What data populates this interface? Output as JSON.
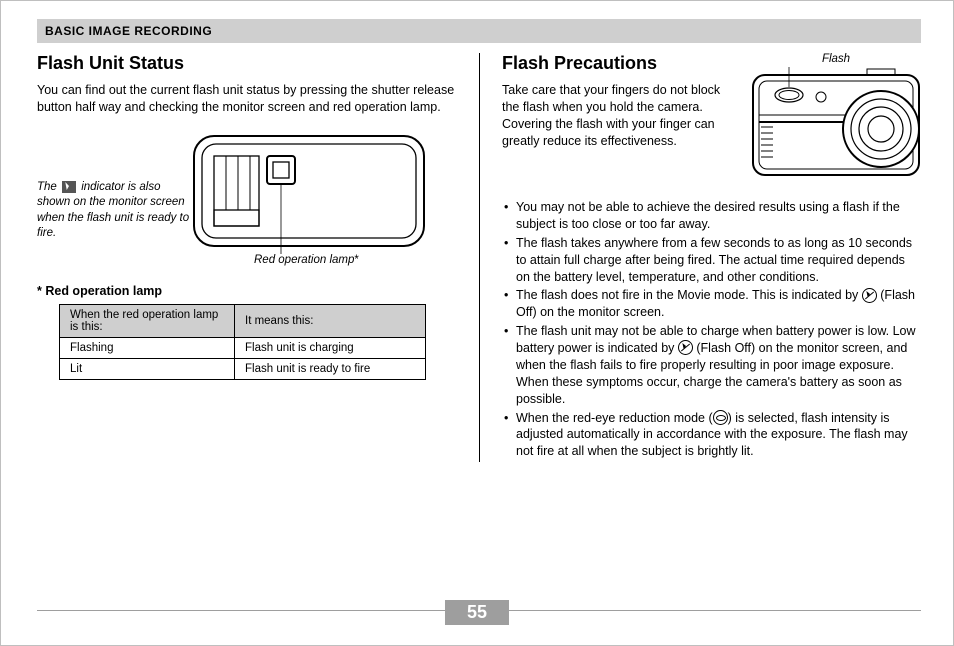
{
  "section_bar": "BASIC IMAGE RECORDING",
  "left": {
    "heading": "Flash Unit Status",
    "intro": "You can find out the current flash unit status by pressing the shutter release button half way and checking the monitor screen and red operation lamp.",
    "caption_before": "The ",
    "caption_after": " indicator is also shown on the monitor screen when the flash unit is ready to fire.",
    "lamp_label": "Red operation lamp",
    "subhead_prefix": "* ",
    "subhead": "Red operation lamp",
    "table": {
      "h1": "When the red operation lamp is this:",
      "h2": "It means this:",
      "r1c1": "Flashing",
      "r1c2": "Flash unit is charging",
      "r2c1": "Lit",
      "r2c2": "Flash unit is ready to fire"
    }
  },
  "right": {
    "heading": "Flash Precautions",
    "intro": "Take care that your fingers do not block the flash when you hold the camera. Covering the flash with your finger can greatly reduce its effectiveness.",
    "flash_label": "Flash",
    "bullets": {
      "b1": "You may not be able to achieve the desired results using a flash if the subject is too close or too far away.",
      "b2": "The flash takes anywhere from a few seconds to as long as 10 seconds to attain full charge after being fired. The actual time required depends on the battery level, temperature, and other conditions.",
      "b3a": "The flash does not fire in the Movie mode. This is indicated by ",
      "b3b": " (Flash Off) on the monitor screen.",
      "b4a": "The flash unit may not be able to charge when battery power is low. Low battery power is indicated by ",
      "b4b": " (Flash Off) on the monitor screen, and when the flash fails to fire properly resulting in poor image exposure. When these symptoms occur, charge the camera's battery as soon as possible.",
      "b5a": "When the red-eye reduction mode (",
      "b5b": ") is selected, flash intensity is adjusted automatically in accordance with the exposure. The flash may not fire at all when the subject is brightly lit."
    }
  },
  "page_number": "55"
}
